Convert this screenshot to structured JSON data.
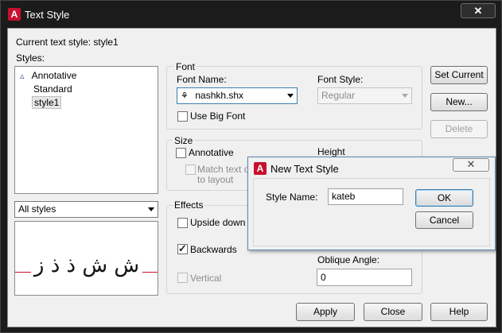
{
  "window": {
    "title": "Text Style",
    "close_glyph": "✕",
    "logo_letter": "A",
    "accent_color": "#c8102e"
  },
  "current_style": {
    "label": "Current text style:",
    "value": "style1"
  },
  "styles_panel": {
    "label": "Styles:",
    "items": [
      {
        "label": "Annotative",
        "icon": "annotative-icon"
      },
      {
        "label": "Standard"
      },
      {
        "label": "style1",
        "selected": true
      }
    ],
    "filter": "All styles"
  },
  "preview": {
    "text": "ش ش ذ ذ ز"
  },
  "font_group": {
    "title": "Font",
    "font_name_label": "Font Name:",
    "font_name_value": "nashkh.shx",
    "font_name_icon": "shx-compass-icon",
    "font_style_label": "Font Style:",
    "font_style_value": "Regular",
    "big_font_label": "Use Big Font",
    "big_font_checked": false
  },
  "size_group": {
    "title": "Size",
    "annotative_label": "Annotative",
    "annotative_checked": false,
    "match_label_1": "Match text or",
    "match_label_2": "to layout",
    "height_label": "Height"
  },
  "effects_group": {
    "title": "Effects",
    "upside_down_label": "Upside down",
    "upside_down_checked": false,
    "backwards_label": "Backwards",
    "backwards_checked": true,
    "check_glyph": "✓",
    "vertical_label": "Vertical",
    "vertical_checked": false,
    "oblique_label": "Oblique Angle:",
    "oblique_value": "0"
  },
  "right_buttons": {
    "set_current": "Set Current",
    "new": "New...",
    "delete": "Delete"
  },
  "bottom_buttons": {
    "apply": "Apply",
    "close": "Close",
    "help": "Help"
  },
  "new_style_dialog": {
    "title": "New Text Style",
    "close_glyph": "✕",
    "style_name_label": "Style Name:",
    "style_name_value": "kateb",
    "ok": "OK",
    "cancel": "Cancel"
  }
}
